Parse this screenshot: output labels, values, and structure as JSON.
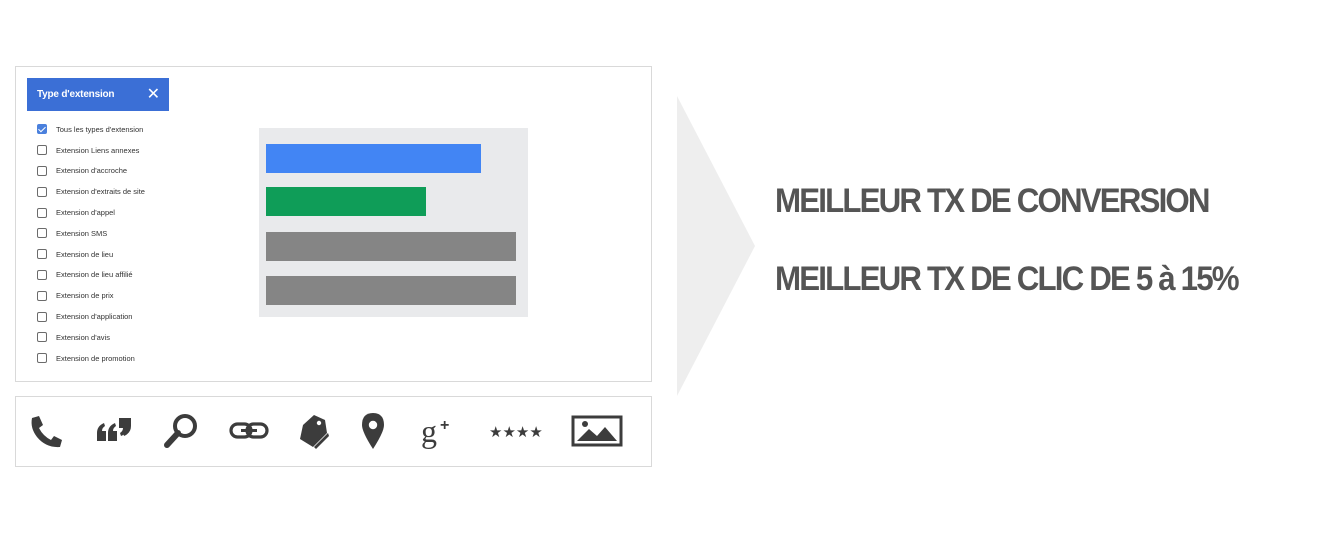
{
  "filter_panel": {
    "title": "Type d'extension",
    "options": [
      {
        "label": "Tous les types d'extension",
        "checked": true
      },
      {
        "label": "Extension Liens annexes",
        "checked": false
      },
      {
        "label": "Extension d'accroche",
        "checked": false
      },
      {
        "label": "Extension d'extraits de site",
        "checked": false
      },
      {
        "label": "Extension d'appel",
        "checked": false
      },
      {
        "label": "Extension SMS",
        "checked": false
      },
      {
        "label": "Extension de lieu",
        "checked": false
      },
      {
        "label": "Extension de lieu affilié",
        "checked": false
      },
      {
        "label": "Extension de prix",
        "checked": false
      },
      {
        "label": "Extension d'application",
        "checked": false
      },
      {
        "label": "Extension d'avis",
        "checked": false
      },
      {
        "label": "Extension de promotion",
        "checked": false
      }
    ]
  },
  "preview": {
    "bars": [
      {
        "color": "#4285f4",
        "fraction": 0.86
      },
      {
        "color": "#0f9d58",
        "fraction": 0.64
      },
      {
        "color": "#858585",
        "fraction": 1.0
      },
      {
        "color": "#858585",
        "fraction": 1.0
      }
    ]
  },
  "icons": [
    "phone-icon",
    "quote-icon",
    "search-icon",
    "link-icon",
    "price-tag-icon",
    "location-pin-icon",
    "google-plus-icon",
    "star-rating-icon",
    "image-icon"
  ],
  "headlines": {
    "line1": "MEILLEUR TX DE CONVERSION",
    "line2": "MEILLEUR TX DE CLIC DE 5 à 15%"
  },
  "colors": {
    "accent": "#3b6fd6",
    "headline": "#555555",
    "icon": "#3c3c3c",
    "arrow": "#eeeeee"
  }
}
